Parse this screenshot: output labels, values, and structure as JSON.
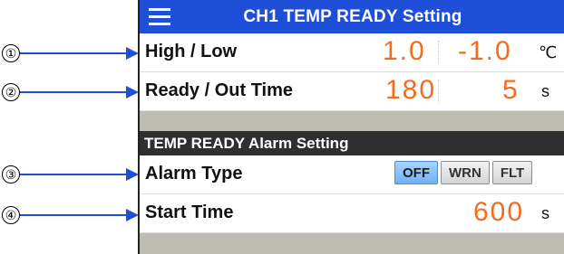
{
  "callouts": [
    "①",
    "②",
    "③",
    "④"
  ],
  "titlebar": {
    "title": "CH1 TEMP READY Setting",
    "menu_icon": "hamburger-icon"
  },
  "rows": {
    "high_low": {
      "label": "High / Low",
      "high": "1.0",
      "low": "-1.0",
      "unit": "℃"
    },
    "ready_out": {
      "label": "Ready / Out Time",
      "ready": "180",
      "out": "5",
      "unit": "s"
    }
  },
  "alarm_section": {
    "header": "TEMP READY Alarm Setting",
    "alarm_type": {
      "label": "Alarm Type",
      "options": [
        "OFF",
        "WRN",
        "FLT"
      ],
      "selected": "OFF"
    },
    "start_time": {
      "label": "Start Time",
      "value": "600",
      "unit": "s"
    }
  },
  "colors": {
    "titlebar": "#1f4fd8",
    "value": "#f26d1f",
    "arrow": "#1f4fd8",
    "section_header": "#2f2f2f",
    "gray_band": "#bdbdb1",
    "selected_option": "#6fb1f3"
  }
}
